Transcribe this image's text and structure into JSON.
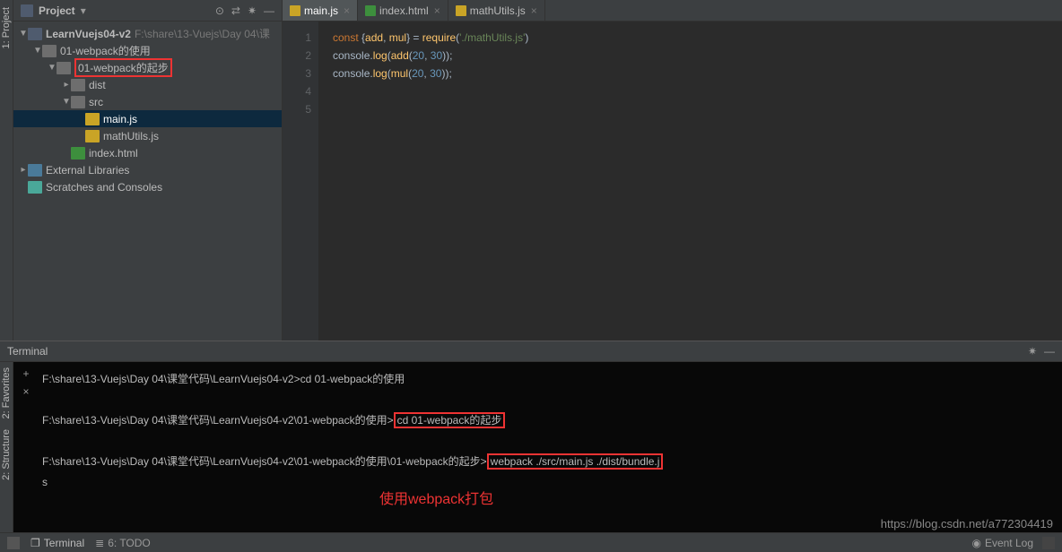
{
  "project_panel": {
    "title": "Project",
    "toolbar": [
      "⊙",
      "⇄",
      "✷",
      "—"
    ],
    "tree": {
      "root": {
        "name": "LearnVuejs04-v2",
        "path": "F:\\share\\13-Vuejs\\Day 04\\课"
      },
      "items": [
        {
          "name": "01-webpack的使用",
          "indent": 1,
          "type": "folder",
          "expanded": true
        },
        {
          "name": "01-webpack的起步",
          "indent": 2,
          "type": "folder",
          "expanded": true,
          "highlighted": true
        },
        {
          "name": "dist",
          "indent": 3,
          "type": "folder"
        },
        {
          "name": "src",
          "indent": 3,
          "type": "folder",
          "expanded": true
        },
        {
          "name": "main.js",
          "indent": 4,
          "type": "js",
          "selected": true
        },
        {
          "name": "mathUtils.js",
          "indent": 4,
          "type": "js"
        },
        {
          "name": "index.html",
          "indent": 3,
          "type": "html"
        }
      ],
      "extlib": "External Libraries",
      "scratches": "Scratches and Consoles"
    }
  },
  "tabs": [
    {
      "name": "main.js",
      "type": "js",
      "active": true
    },
    {
      "name": "index.html",
      "type": "html"
    },
    {
      "name": "mathUtils.js",
      "type": "js"
    }
  ],
  "editor": {
    "lines": [
      {
        "n": 1,
        "tokens": [
          [
            "kw",
            "const"
          ],
          [
            "",
            " {"
          ],
          [
            "fn",
            "add"
          ],
          [
            "",
            ", "
          ],
          [
            "fn",
            "mul"
          ],
          [
            "",
            "} = "
          ],
          [
            "fn",
            "require"
          ],
          [
            "",
            "("
          ],
          [
            "str",
            "'./mathUtils.js'"
          ],
          [
            "",
            ")"
          ]
        ]
      },
      {
        "n": 2,
        "tokens": [
          [
            "",
            ""
          ]
        ]
      },
      {
        "n": 3,
        "tokens": [
          [
            "",
            "console."
          ],
          [
            "fn",
            "log"
          ],
          [
            "",
            "("
          ],
          [
            "fn",
            "add"
          ],
          [
            "",
            "("
          ],
          [
            "num",
            "20"
          ],
          [
            "",
            ", "
          ],
          [
            "num",
            "30"
          ],
          [
            "",
            "));"
          ]
        ]
      },
      {
        "n": 4,
        "tokens": [
          [
            "",
            "console."
          ],
          [
            "fn",
            "log"
          ],
          [
            "",
            "("
          ],
          [
            "fn",
            "mul"
          ],
          [
            "",
            "("
          ],
          [
            "num",
            "20"
          ],
          [
            "",
            ", "
          ],
          [
            "num",
            "30"
          ],
          [
            "",
            "));"
          ]
        ]
      },
      {
        "n": 5,
        "tokens": [
          [
            "",
            ""
          ]
        ]
      }
    ]
  },
  "terminal": {
    "title": "Terminal",
    "lines": [
      {
        "prompt": "F:\\share\\13-Vuejs\\Day 04\\课堂代码\\LearnVuejs04-v2>",
        "cmd": "cd 01-webpack的使用"
      },
      {
        "blank": true
      },
      {
        "prompt": "F:\\share\\13-Vuejs\\Day 04\\课堂代码\\LearnVuejs04-v2\\01-webpack的使用>",
        "cmd": "cd 01-webpack的起步",
        "boxcmd": true
      },
      {
        "blank": true
      },
      {
        "prompt": "F:\\share\\13-Vuejs\\Day 04\\课堂代码\\LearnVuejs04-v2\\01-webpack的使用\\01-webpack的起步>",
        "cmd": "webpack ./src/main.js ./dist/bundle.j",
        "boxcmd": true
      },
      {
        "cont": "s"
      }
    ],
    "annotation": "使用webpack打包"
  },
  "left_sidebar": [
    "1: Project"
  ],
  "left_sidebar_bottom": [
    "2: Favorites",
    "2: Structure"
  ],
  "bottom": {
    "terminal": "Terminal",
    "todo": "6: TODO",
    "eventlog": "Event Log"
  },
  "watermark": "https://blog.csdn.net/a772304419"
}
